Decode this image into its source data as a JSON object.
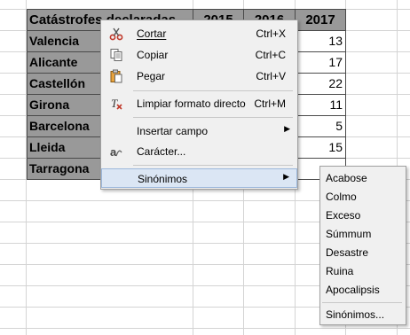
{
  "sheet": {
    "header": [
      "Catástrofes declaradas",
      "2015",
      "2016",
      "2017"
    ],
    "rows": [
      {
        "name": "Valencia",
        "v2017": "13"
      },
      {
        "name": "Alicante",
        "v2017": "17"
      },
      {
        "name": "Castellón",
        "v2017": "22"
      },
      {
        "name": "Girona",
        "v2017": "11"
      },
      {
        "name": "Barcelona",
        "v2017": "5"
      },
      {
        "name": "Lleida",
        "v2017": "15"
      },
      {
        "name": "Tarragona",
        "v2017": ""
      }
    ]
  },
  "context_menu": {
    "items": [
      {
        "label": "Cortar",
        "shortcut": "Ctrl+X",
        "icon": "scissors-icon"
      },
      {
        "label": "Copiar",
        "shortcut": "Ctrl+C",
        "icon": "copy-icon"
      },
      {
        "label": "Pegar",
        "shortcut": "Ctrl+V",
        "icon": "paste-icon"
      },
      {
        "label": "Limpiar formato directo",
        "shortcut": "Ctrl+M",
        "icon": "clear-format-icon"
      },
      {
        "label": "Insertar campo",
        "icon": "submenu-arrow-icon"
      },
      {
        "label": "Carácter...",
        "icon": "character-icon"
      },
      {
        "label": "Sinónimos",
        "icon": "submenu-arrow-icon"
      }
    ]
  },
  "synonyms_submenu": {
    "items": [
      "Acabose",
      "Colmo",
      "Exceso",
      "Súmmum",
      "Desastre",
      "Ruina",
      "Apocalipsis"
    ],
    "more_label": "Sinónimos..."
  }
}
